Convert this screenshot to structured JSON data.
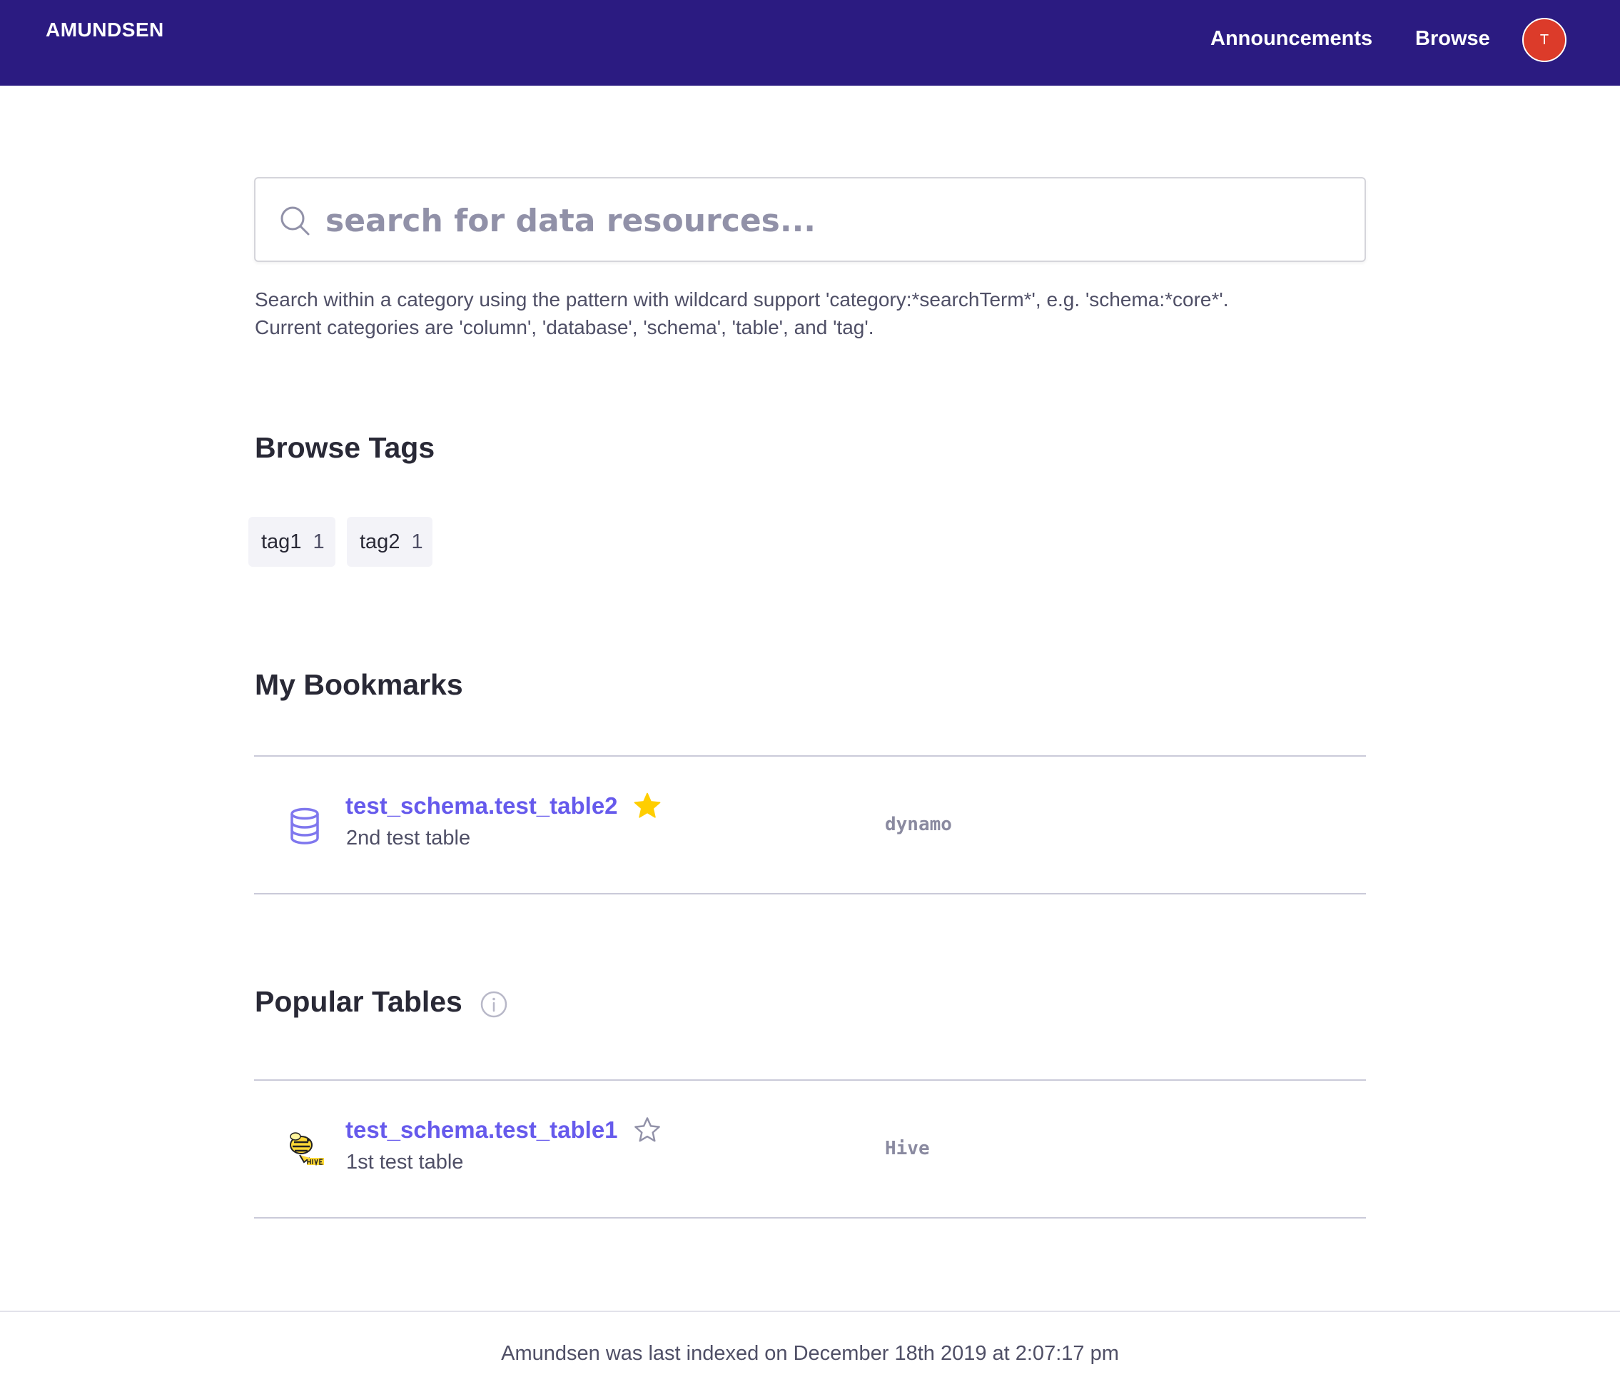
{
  "header": {
    "brand": "AMUNDSEN",
    "nav": [
      "Announcements",
      "Browse"
    ],
    "avatar_initial": "T",
    "background_color": "#2b1b81",
    "avatar_color": "#dc3b2a"
  },
  "search": {
    "placeholder": "search for data resources...",
    "value": "",
    "help_line1": "Search within a category using the pattern with wildcard support 'category:*searchTerm*', e.g. 'schema:*core*'.",
    "help_line2": "Current categories are 'column', 'database', 'schema', 'table', and 'tag'."
  },
  "browse_tags": {
    "title": "Browse Tags",
    "tags": [
      {
        "name": "tag1",
        "count": "1"
      },
      {
        "name": "tag2",
        "count": "1"
      }
    ]
  },
  "bookmarks": {
    "title": "My Bookmarks",
    "items": [
      {
        "name": "test_schema.test_table2",
        "description": "2nd test table",
        "source": "dynamo",
        "icon": "database-icon",
        "bookmarked": true
      }
    ]
  },
  "popular": {
    "title": "Popular Tables",
    "items": [
      {
        "name": "test_schema.test_table1",
        "description": "1st test table",
        "source": "Hive",
        "icon": "hive-logo-icon",
        "bookmarked": false
      }
    ]
  },
  "footer": {
    "text": "Amundsen was last indexed on December 18th 2019 at 2:07:17 pm"
  },
  "colors": {
    "link": "#665aec",
    "star_filled": "#ffce00",
    "star_empty": "#9191a8"
  }
}
